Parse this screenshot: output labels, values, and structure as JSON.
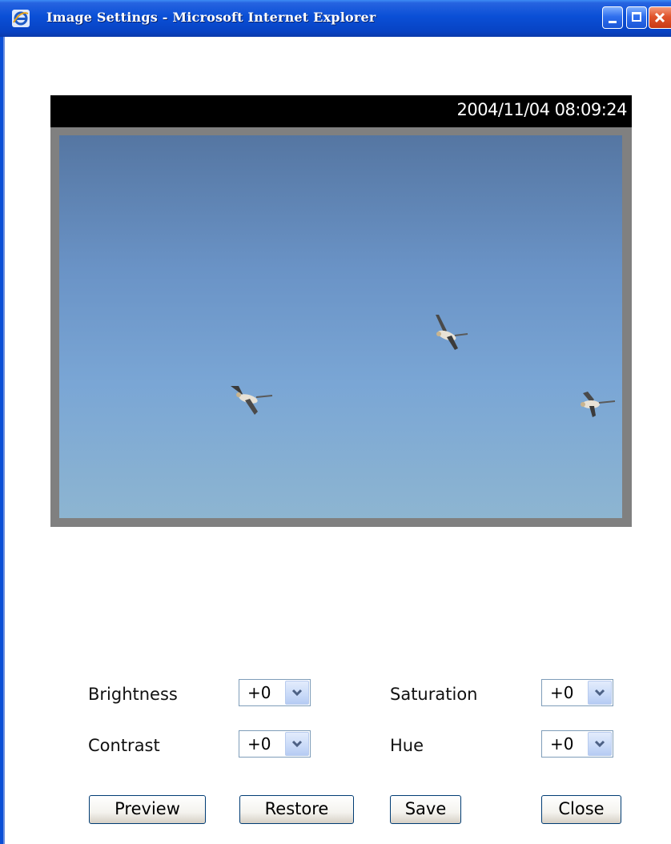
{
  "window": {
    "title": "Image Settings - Microsoft Internet Explorer",
    "icons": [
      "ie-icon",
      "minimize-icon",
      "maximize-icon",
      "close-icon"
    ]
  },
  "video": {
    "timestamp": "2004/11/04 08:09:24"
  },
  "settings": {
    "brightness": {
      "label": "Brightness",
      "value": "+0"
    },
    "saturation": {
      "label": "Saturation",
      "value": "+0"
    },
    "contrast": {
      "label": "Contrast",
      "value": "+0"
    },
    "hue": {
      "label": "Hue",
      "value": "+0"
    }
  },
  "buttons": {
    "preview": "Preview",
    "restore": "Restore",
    "save": "Save",
    "close": "Close"
  }
}
